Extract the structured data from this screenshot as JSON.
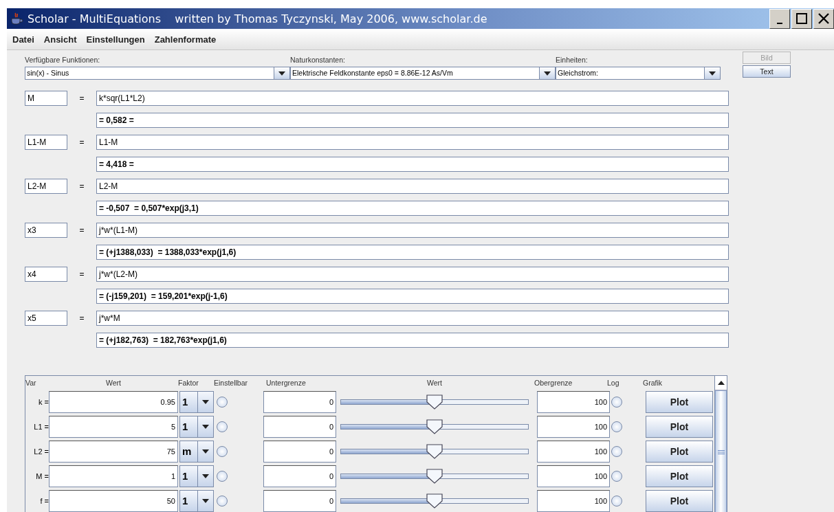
{
  "window": {
    "title": "Scholar - MultiEquations    written by Thomas Tyczynski, May 2006, www.scholar.de"
  },
  "menu": [
    "Datei",
    "Ansicht",
    "Einstellungen",
    "Zahlenformate"
  ],
  "selectors": [
    {
      "label": "Verfügbare Funktionen:",
      "value": "sin(x) - Sinus"
    },
    {
      "label": "Naturkonstanten:",
      "value": "Elektrische Feldkonstante eps0 = 8.86E-12 As/Vm"
    },
    {
      "label": "Einheiten:",
      "value": "Gleichstrom:"
    }
  ],
  "view_buttons": [
    {
      "label": "Bild",
      "disabled": true
    },
    {
      "label": "Text",
      "disabled": false
    }
  ],
  "equations": [
    {
      "name": "M",
      "equals": "=",
      "expression": "k*sqr(L1*L2)",
      "result": "= 0,582 ="
    },
    {
      "name": "L1-M",
      "equals": "=",
      "expression": "L1-M",
      "result": "= 4,418 ="
    },
    {
      "name": "L2-M",
      "equals": "=",
      "expression": "L2-M",
      "result": "= -0,507  = 0,507*exp(j3,1)"
    },
    {
      "name": "x3",
      "equals": "=",
      "expression": "j*w*(L1-M)",
      "result": "= (+j1388,033)  = 1388,033*exp(j1,6)"
    },
    {
      "name": "x4",
      "equals": "=",
      "expression": "j*w*(L2-M)",
      "result": "= (-j159,201)  = 159,201*exp(j-1,6)"
    },
    {
      "name": "x5",
      "equals": "=",
      "expression": "j*w*M",
      "result": "= (+j182,763)  = 182,763*exp(j1,6)"
    }
  ],
  "variables": {
    "columns": [
      "Var",
      "Wert",
      "Faktor",
      "Einstellbar",
      "Untergrenze",
      "Wert",
      "Obergrenze",
      "Log",
      "Grafik"
    ],
    "rows": [
      {
        "var": "k =",
        "value": "0.95",
        "factor": "1",
        "adjustable": false,
        "lower": "0",
        "level": 0.5,
        "upper": "100",
        "log": false,
        "button": "Plot"
      },
      {
        "var": "L1 =",
        "value": "5",
        "factor": "1",
        "adjustable": false,
        "lower": "0",
        "level": 0.5,
        "upper": "100",
        "log": false,
        "button": "Plot"
      },
      {
        "var": "L2 =",
        "value": "75",
        "factor": "m",
        "adjustable": false,
        "lower": "0",
        "level": 0.5,
        "upper": "100",
        "log": false,
        "button": "Plot"
      },
      {
        "var": "M =",
        "value": "1",
        "factor": "1",
        "adjustable": false,
        "lower": "0",
        "level": 0.5,
        "upper": "100",
        "log": false,
        "button": "Plot"
      },
      {
        "var": "f =",
        "value": "50",
        "factor": "1",
        "adjustable": false,
        "lower": "0",
        "level": 0.5,
        "upper": "100",
        "log": false,
        "button": "Plot"
      }
    ]
  }
}
